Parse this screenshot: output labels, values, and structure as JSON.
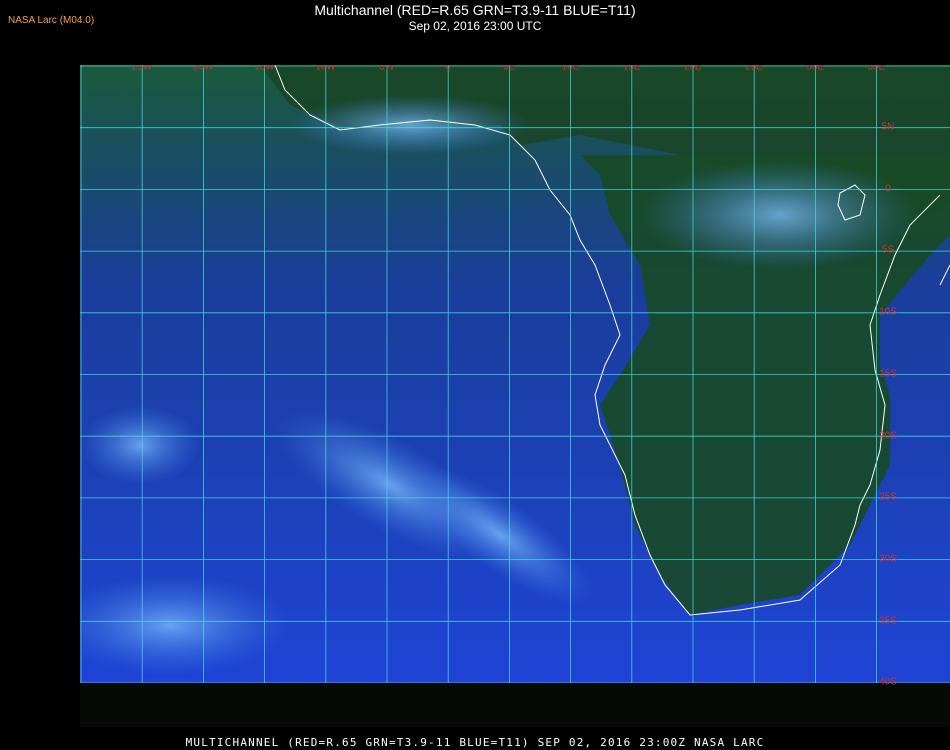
{
  "header": {
    "credit": "NASA Larc (M04.0)",
    "title": "Multichannel (RED=R.65 GRN=T3.9-11 BLUE=T11)",
    "subtitle": "Sep 02, 2016 23:00 UTC"
  },
  "footer": {
    "caption": "MULTICHANNEL (RED=R.65 GRN=T3.9-11 BLUE=T11) SEP 02, 2016 23:00Z   NASA LARC"
  },
  "map": {
    "lon_labels": [
      "25W",
      "20W",
      "15W",
      "10W",
      "5W",
      "0",
      "5E",
      "10E",
      "15E",
      "20E",
      "25E",
      "30E",
      "35E"
    ],
    "lat_labels": [
      "5N",
      "0",
      "5S",
      "10S",
      "15S",
      "20S",
      "25S",
      "30S",
      "35S",
      "40S"
    ],
    "colors": {
      "ocean": "#1a3acc",
      "land": "#163a20",
      "cloud": "#66aaee",
      "grid": "#40e0e0",
      "coast": "#ffffff",
      "label": "#d03030"
    }
  }
}
